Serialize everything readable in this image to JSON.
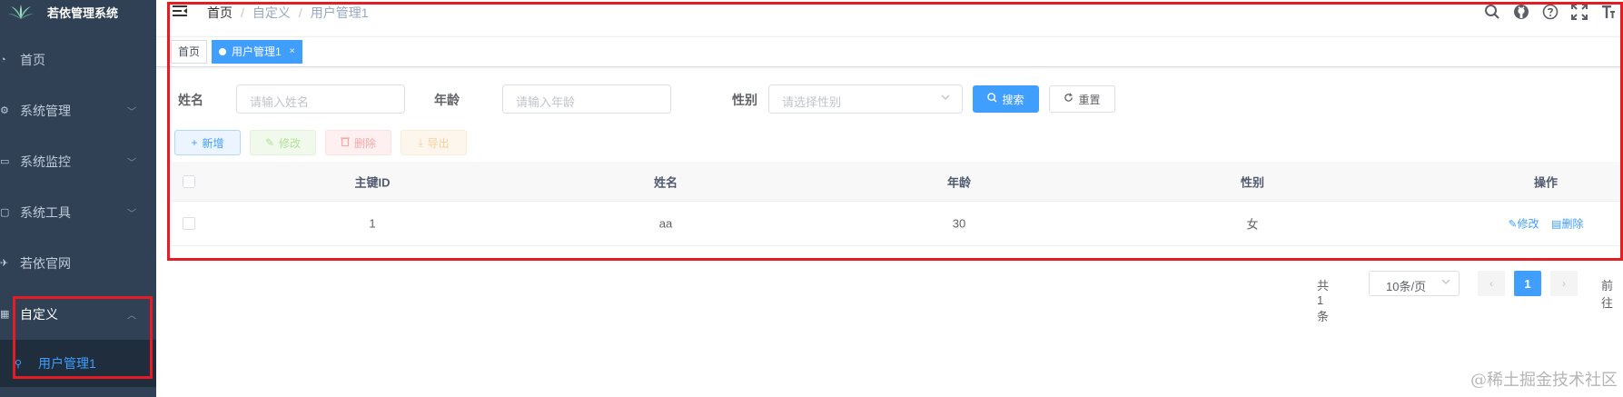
{
  "app": {
    "title": "若依管理系统"
  },
  "sidebar": {
    "items": [
      {
        "label": "首页",
        "icon": "dashboard-icon",
        "glyph": "◔"
      },
      {
        "label": "系统管理",
        "icon": "settings-icon",
        "glyph": "⚙",
        "chevron": "﹀"
      },
      {
        "label": "系统监控",
        "icon": "monitor-icon",
        "glyph": "▭",
        "chevron": "﹀"
      },
      {
        "label": "系统工具",
        "icon": "tool-icon",
        "glyph": "▢",
        "chevron": "﹀"
      },
      {
        "label": "若依官网",
        "icon": "guide-icon",
        "glyph": "✈"
      },
      {
        "label": "自定义",
        "icon": "table-icon",
        "glyph": "▦",
        "chevron": "︿"
      }
    ],
    "submenu": {
      "label": "用户管理1",
      "icon": "user-icon",
      "glyph": "⚲"
    }
  },
  "navbar": {
    "breadcrumb": [
      "首页",
      "自定义",
      "用户管理1"
    ],
    "separator": "/",
    "icons": [
      "search-icon",
      "github-icon",
      "question-icon",
      "fullscreen-icon",
      "font-size-icon"
    ]
  },
  "tags": [
    {
      "label": "首页",
      "active": false
    },
    {
      "label": "用户管理1",
      "active": true,
      "close": "×"
    }
  ],
  "search_form": {
    "name_label": "姓名",
    "name_placeholder": "请输入姓名",
    "age_label": "年龄",
    "age_placeholder": "请输入年龄",
    "gender_label": "性别",
    "gender_placeholder": "请选择性别",
    "search_button": "搜索",
    "reset_button": "重置"
  },
  "toolbar": {
    "add": "新增",
    "edit": "修改",
    "delete": "删除",
    "export": "导出"
  },
  "table": {
    "columns": [
      "主键ID",
      "姓名",
      "年龄",
      "性别",
      "操作"
    ],
    "rows": [
      {
        "id": "1",
        "name": "aa",
        "age": "30",
        "gender": "女",
        "edit": "修改",
        "delete": "删除"
      }
    ]
  },
  "pagination": {
    "total": "共 1 条",
    "page_size": "10条/页",
    "current_page": "1",
    "jump": "前往"
  },
  "watermark": "@稀土掘金技术社区",
  "colors": {
    "sidebar_bg": "#304156",
    "primary": "#409eff",
    "highlight_box": "#e51c23"
  }
}
